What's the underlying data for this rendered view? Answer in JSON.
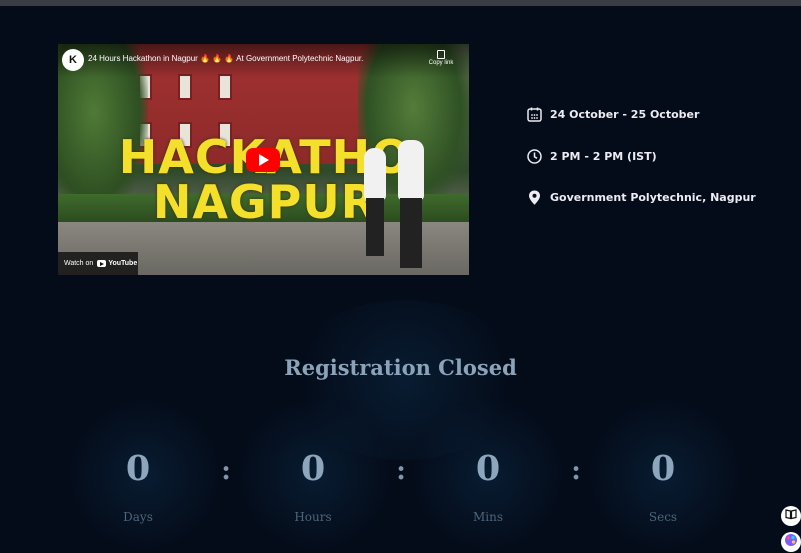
{
  "video": {
    "caption": "24 Hours Hackathon in Nagpur 🔥 🔥 🔥 At Government Polytechnic Nagpur.",
    "logo_text": "K",
    "copy_link_label": "Copy link",
    "thumb_line1": "HACKATHO",
    "thumb_line2": "NAGPUR",
    "watch_on_label": "Watch on",
    "youtube_label": "YouTube"
  },
  "event": {
    "date": "24 October - 25 October",
    "time": "2 PM - 2 PM (IST)",
    "location": "Government Polytechnic, Nagpur"
  },
  "registration": {
    "status": "Registration Closed"
  },
  "countdown": {
    "separator": ":",
    "units": [
      {
        "value": "0",
        "label": "Days"
      },
      {
        "value": "0",
        "label": "Hours"
      },
      {
        "value": "0",
        "label": "Mins"
      },
      {
        "value": "0",
        "label": "Secs"
      }
    ]
  },
  "colors": {
    "background": "#040c1a",
    "title": "#8aa3b8",
    "countdown_number": "#8da6bb",
    "countdown_label": "#4f6578",
    "thumb_text": "#f4e02a",
    "youtube_red": "#ff0000"
  },
  "icons": {
    "date": "calendar-icon",
    "time": "clock-icon",
    "location": "map-pin-icon",
    "side_top": "book-icon",
    "side_bottom": "palette-icon"
  }
}
